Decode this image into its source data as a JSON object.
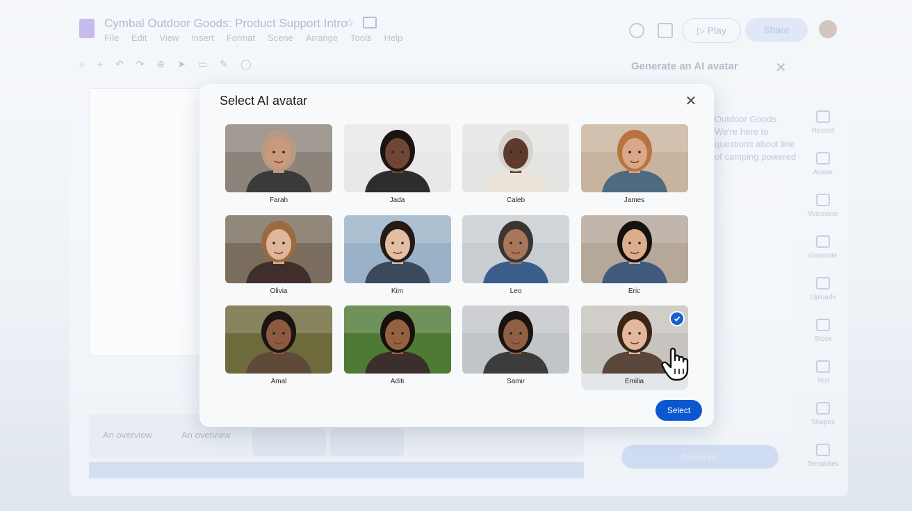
{
  "app": {
    "title": "Cymbal Outdoor Goods: Product Support Intro",
    "menu": [
      "File",
      "Edit",
      "View",
      "Insert",
      "Format",
      "Scene",
      "Arrange",
      "Tools",
      "Help"
    ],
    "play_label": "Play",
    "share_label": "Share"
  },
  "timeline": {
    "label_1": "An overview",
    "label_2": "An overview"
  },
  "right_panel": {
    "title": "Generate an AI avatar",
    "intro_text": "Outdoor Goods We're here to questions about line of camping powered",
    "generate_label": "Generate",
    "rail": [
      "Record",
      "Avatar",
      "Voiceover",
      "Generate",
      "Uploads",
      "Stock",
      "Text",
      "Shapes",
      "Templates"
    ]
  },
  "modal": {
    "title": "Select AI avatar",
    "select_label": "Select",
    "avatars": [
      {
        "name": "Farah",
        "skin": "#c99a7c",
        "hair": "#b89a82",
        "bg": "#8c847a",
        "accent": "#3a3a3a"
      },
      {
        "name": "Jada",
        "skin": "#6f4634",
        "hair": "#1c1410",
        "bg": "#e8e8e8",
        "accent": "#2d2d2d"
      },
      {
        "name": "Caleb",
        "skin": "#5c3b2c",
        "hair": "#d7d2cc",
        "bg": "#e4e4e2",
        "accent": "#e9e3da"
      },
      {
        "name": "James",
        "skin": "#d9a889",
        "hair": "#b8733f",
        "bg": "#c8b49e",
        "accent": "#4e6a80"
      },
      {
        "name": "Olivia",
        "skin": "#e0b59a",
        "hair": "#9b6a3f",
        "bg": "#7a6d5e",
        "accent": "#3f2e2a"
      },
      {
        "name": "Kim",
        "skin": "#e4bea3",
        "hair": "#241a15",
        "bg": "#9ab2c8",
        "accent": "#3b4a5b"
      },
      {
        "name": "Leo",
        "skin": "#a8775a",
        "hair": "#3a3532",
        "bg": "#c8cdd1",
        "accent": "#3a5d8c"
      },
      {
        "name": "Eric",
        "skin": "#dcae8e",
        "hair": "#15110f",
        "bg": "#b5a79a",
        "accent": "#3f5a7c"
      },
      {
        "name": "Amal",
        "skin": "#8b5a3f",
        "hair": "#1b1411",
        "bg": "#6d6a3c",
        "accent": "#5f4a3a"
      },
      {
        "name": "Aditi",
        "skin": "#93623f",
        "hair": "#16110e",
        "bg": "#4f7a35",
        "accent": "#3a2f2a"
      },
      {
        "name": "Samir",
        "skin": "#8e5f42",
        "hair": "#1a1411",
        "bg": "#c2c5c8",
        "accent": "#3c3c3c"
      },
      {
        "name": "Emilia",
        "skin": "#e3b89d",
        "hair": "#3b2518",
        "bg": "#c7c4bf",
        "accent": "#5a463a"
      }
    ],
    "selected_index": 11
  }
}
